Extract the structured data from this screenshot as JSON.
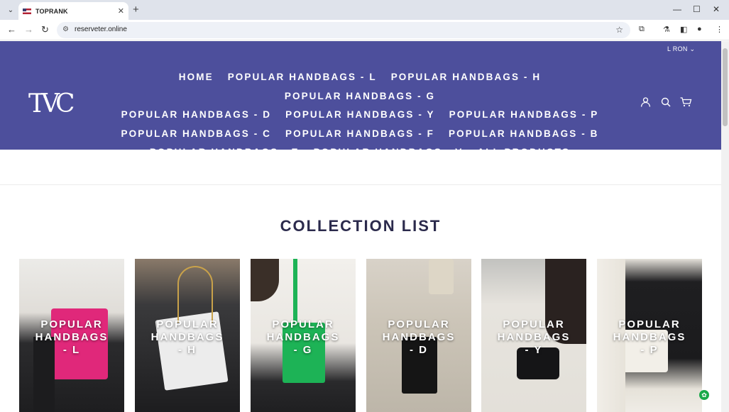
{
  "browser": {
    "tab_title": "TOPRANK",
    "url": "reserveter.online"
  },
  "header": {
    "currency": "L RON",
    "logo": "TVC",
    "nav": [
      "HOME",
      "POPULAR HANDBAGS - L",
      "POPULAR HANDBAGS - H",
      "POPULAR HANDBAGS - G",
      "POPULAR HANDBAGS - D",
      "POPULAR HANDBAGS - Y",
      "POPULAR HANDBAGS - P",
      "POPULAR HANDBAGS - C",
      "POPULAR HANDBAGS - F",
      "POPULAR HANDBAGS - B",
      "POPULAR HANDBAGS - E",
      "POPULAR HANDBAGS - V",
      "ALL PRODUCTS"
    ],
    "icons": [
      "account-icon",
      "search-icon",
      "cart-icon"
    ],
    "background": "#4d4f9c"
  },
  "collection": {
    "title": "COLLECTION LIST",
    "cards": [
      {
        "line1": "POPULAR",
        "line2": "HANDBAGS",
        "line3": "- L"
      },
      {
        "line1": "POPULAR",
        "line2": "HANDBAGS",
        "line3": "- H"
      },
      {
        "line1": "POPULAR",
        "line2": "HANDBAGS",
        "line3": "- G"
      },
      {
        "line1": "POPULAR",
        "line2": "HANDBAGS",
        "line3": "- D"
      },
      {
        "line1": "POPULAR",
        "line2": "HANDBAGS",
        "line3": "- Y"
      },
      {
        "line1": "POPULAR",
        "line2": "HANDBAGS",
        "line3": "- P"
      }
    ]
  }
}
